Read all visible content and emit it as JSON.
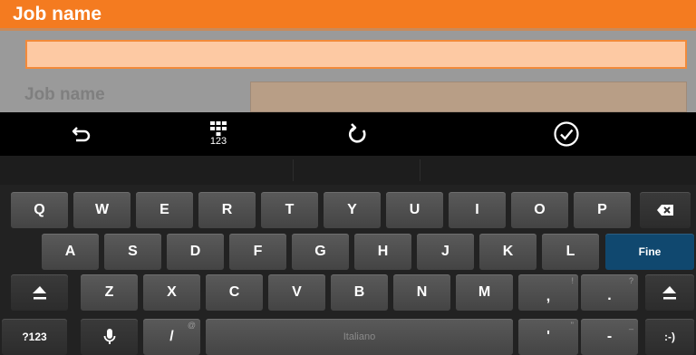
{
  "dialog": {
    "title": "Job name",
    "input_value": "",
    "form_label": "Job name",
    "form_value": ""
  },
  "action_bar": {
    "undo_icon": "undo-icon",
    "numpad_icon": "numpad-icon",
    "numpad_label": "123",
    "redo_icon": "redo-icon",
    "done_icon": "check-circle-icon"
  },
  "keyboard": {
    "row1": [
      "Q",
      "W",
      "E",
      "R",
      "T",
      "Y",
      "U",
      "I",
      "O",
      "P"
    ],
    "row2": [
      "A",
      "S",
      "D",
      "F",
      "G",
      "H",
      "J",
      "K",
      "L"
    ],
    "row3": [
      "Z",
      "X",
      "C",
      "V",
      "B",
      "N",
      "M"
    ],
    "comma": ",",
    "comma_hint": "!",
    "period": ".",
    "period_hint": "?",
    "enter_label": "Fine",
    "symbols_label": "?123",
    "slash": "/",
    "slash_hint": "@",
    "space_label": "Italiano",
    "apostrophe": "'",
    "apostrophe_hint": "\"",
    "dash": "-",
    "dash_hint": "_",
    "emoticon": ":-)",
    "backspace_icon": "backspace-icon",
    "shift_icon": "shift-icon",
    "mic_icon": "microphone-icon"
  }
}
